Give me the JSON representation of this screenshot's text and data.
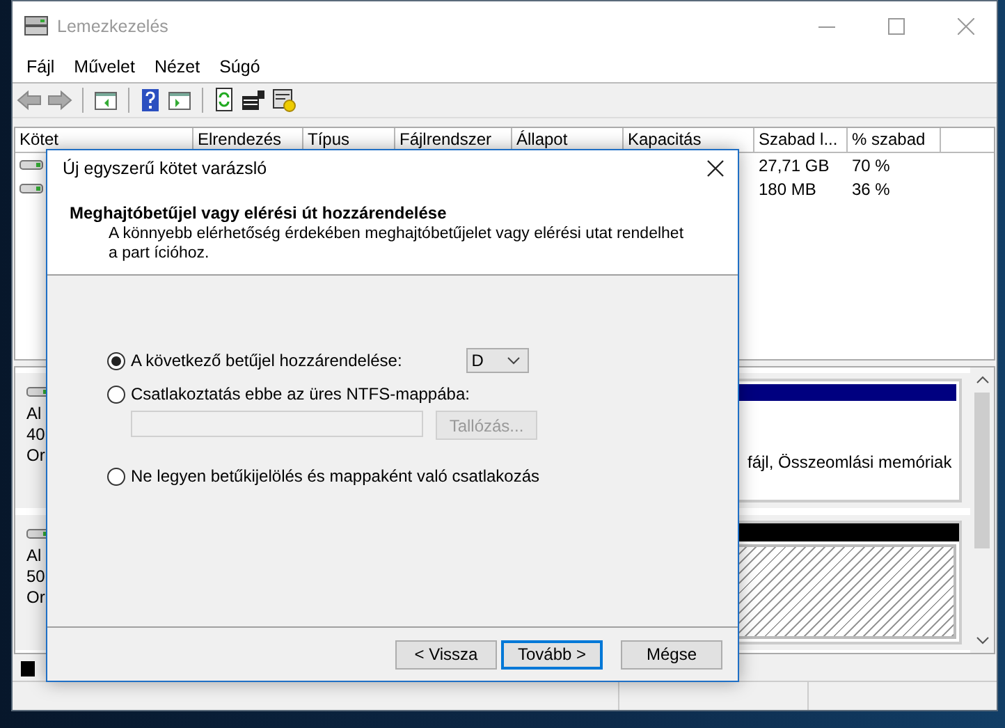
{
  "window": {
    "title": "Lemezkezelés"
  },
  "menu": [
    {
      "label": "Fájl"
    },
    {
      "label": "Művelet"
    },
    {
      "label": "Nézet"
    },
    {
      "label": "Súgó"
    }
  ],
  "volume_table": {
    "columns": [
      "Kötet",
      "Elrendezés",
      "Típus",
      "Fájlrendszer",
      "Állapot",
      "Kapacitás",
      "Szabad l...",
      "% szabad"
    ],
    "rows": [
      {
        "free": "27,71 GB",
        "percent_free": "70 %"
      },
      {
        "free": "180 MB",
        "percent_free": "36 %"
      }
    ]
  },
  "disks": [
    {
      "label_lines": [
        "Al",
        "40",
        "Or"
      ],
      "partitions": [
        {
          "kind": "primary",
          "text": "fájl, Összeomlási memóriak"
        }
      ]
    },
    {
      "label_lines": [
        "Al",
        "50",
        "Or"
      ],
      "partitions": [
        {
          "kind": "unallocated"
        }
      ]
    }
  ],
  "legend": [
    {
      "kind": "unallocated"
    }
  ],
  "dialog": {
    "title": "Új egyszerű kötet varázsló",
    "heading": "Meghajtóbetűjel vagy elérési út hozzárendelése",
    "description": "A könnyebb elérhetőség érdekében meghajtóbetűjelet vagy elérési utat rendelhet\na part ícióhoz.",
    "options": [
      {
        "kind": "letter",
        "label": "A következő betűjel hozzárendelése:",
        "selected": true,
        "value": "D"
      },
      {
        "kind": "folder",
        "label": "Csatlakoztatás ebbe az üres NTFS-mappába:",
        "selected": false,
        "browse": "Tallózás..."
      },
      {
        "kind": "none",
        "label": "Ne legyen betűkijelölés és mappaként való csatlakozás",
        "selected": false
      }
    ],
    "buttons": [
      {
        "label": "< Vissza",
        "focused": false
      },
      {
        "label": "Tovább >",
        "focused": true
      },
      {
        "label": "Mégse",
        "focused": false
      }
    ]
  }
}
